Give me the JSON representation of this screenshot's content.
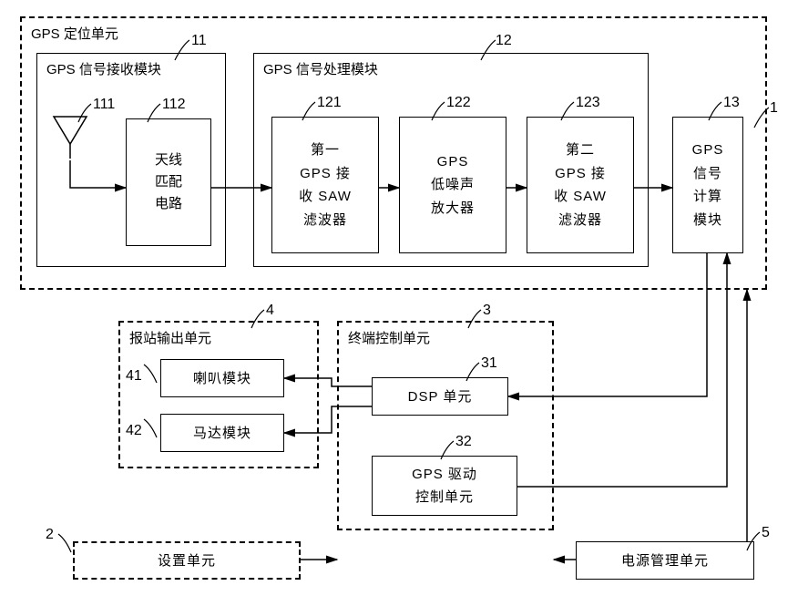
{
  "gps_unit": {
    "title": "GPS 定位单元",
    "ref": "1",
    "rx_module": {
      "title": "GPS 信号接收模块",
      "ref": "11",
      "antenna_ref": "111",
      "match_ref": "112",
      "match_label_l1": "天线",
      "match_label_l2": "匹配",
      "match_label_l3": "电路"
    },
    "proc_module": {
      "title": "GPS 信号处理模块",
      "ref": "12",
      "saw1": {
        "ref": "121",
        "l1": "第一",
        "l2": "GPS 接",
        "l3": "收 SAW",
        "l4": "滤波器"
      },
      "lna": {
        "ref": "122",
        "l1": "GPS",
        "l2": "低噪声",
        "l3": "放大器"
      },
      "saw2": {
        "ref": "123",
        "l1": "第二",
        "l2": "GPS 接",
        "l3": "收 SAW",
        "l4": "滤波器"
      }
    },
    "calc_module": {
      "ref": "13",
      "l1": "GPS",
      "l2": "信号",
      "l3": "计算",
      "l4": "模块"
    }
  },
  "announce_unit": {
    "title": "报站输出单元",
    "ref": "4",
    "speaker": {
      "ref": "41",
      "label": "喇叭模块"
    },
    "motor": {
      "ref": "42",
      "label": "马达模块"
    }
  },
  "terminal_unit": {
    "title": "终端控制单元",
    "ref": "3",
    "dsp": {
      "ref": "31",
      "label": "DSP 单元"
    },
    "gps_drv": {
      "ref": "32",
      "l1": "GPS 驱动",
      "l2": "控制单元"
    }
  },
  "settings_unit": {
    "ref": "2",
    "label": "设置单元"
  },
  "power_unit": {
    "ref": "5",
    "label": "电源管理单元"
  }
}
